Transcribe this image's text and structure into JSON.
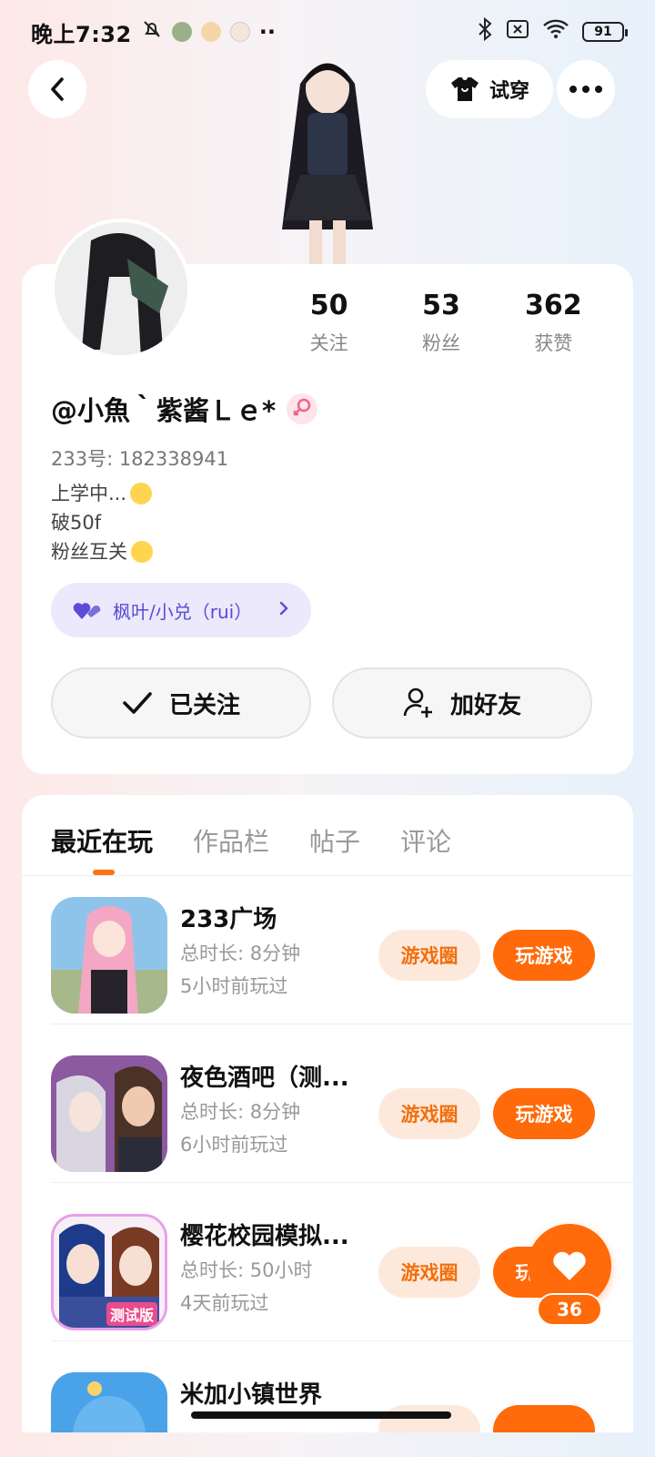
{
  "status_bar": {
    "time": "晚上7:32",
    "battery": "91",
    "more": "··"
  },
  "header": {
    "try_on_label": "试穿"
  },
  "profile": {
    "username": "@小魚｀紫酱Ｌｅ*",
    "uid": "233号: 182338941",
    "bio": [
      "上学中...",
      "破50f",
      "粉丝互关"
    ],
    "stats": [
      {
        "value": "50",
        "label": "关注"
      },
      {
        "value": "53",
        "label": "粉丝"
      },
      {
        "value": "362",
        "label": "获赞"
      }
    ],
    "cp_tag": "枫叶/小兑（rui）",
    "followed_label": "已关注",
    "add_friend_label": "加好友"
  },
  "tabs": [
    "最近在玩",
    "作品栏",
    "帖子",
    "评论"
  ],
  "games": [
    {
      "name": "233广场",
      "duration": "总时长: 8分钟",
      "last_played": "5小时前玩过"
    },
    {
      "name": "夜色酒吧（测...",
      "duration": "总时长: 8分钟",
      "last_played": "6小时前玩过"
    },
    {
      "name": "樱花校园模拟...",
      "duration": "总时长: 50小时",
      "last_played": "4天前玩过",
      "icon_badge": "测试版"
    },
    {
      "name": "米加小镇世界",
      "duration": "",
      "last_played": ""
    }
  ],
  "game_buttons": {
    "circle": "游戏圈",
    "play": "玩游戏"
  },
  "like_count": "36",
  "colors": {
    "accent": "#ff6a0a",
    "cp_tag_bg": "#ebe9fb",
    "cp_tag_text": "#5b4bd6"
  }
}
